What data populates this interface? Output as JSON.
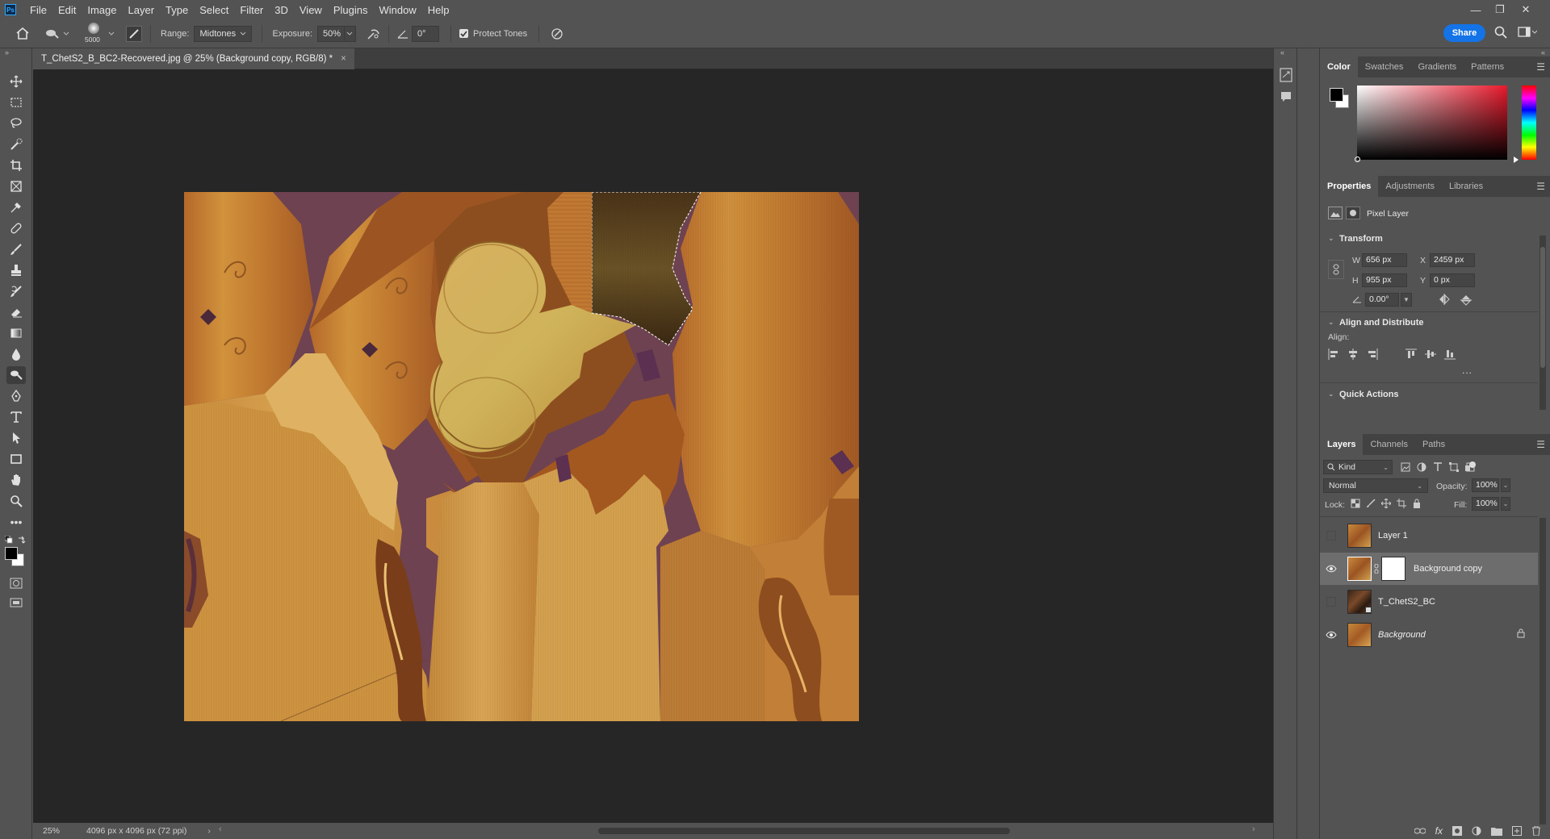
{
  "app": {
    "logo": "Ps"
  },
  "menu": [
    "File",
    "Edit",
    "Image",
    "Layer",
    "Type",
    "Select",
    "Filter",
    "3D",
    "View",
    "Plugins",
    "Window",
    "Help"
  ],
  "window_controls": [
    "minimize-icon",
    "restore-icon",
    "close-icon"
  ],
  "options": {
    "brush_size": "5000",
    "range_label": "Range:",
    "range_value": "Midtones",
    "exposure_label": "Exposure:",
    "exposure_value": "50%",
    "angle_value": "0°",
    "protect_tones_label": "Protect Tones",
    "protect_tones_checked": true,
    "share_label": "Share"
  },
  "document": {
    "tab_title": "T_ChetS2_B_BC2-Recovered.jpg @ 25% (Background copy, RGB/8) *",
    "close": "×",
    "zoom": "25%",
    "info": "4096 px x 4096 px (72 ppi)"
  },
  "tools": [
    "move-tool",
    "marquee-tool",
    "lasso-tool",
    "quick-selection-tool",
    "crop-tool",
    "frame-tool",
    "eyedropper-tool",
    "healing-brush-tool",
    "brush-tool",
    "clone-stamp-tool",
    "history-brush-tool",
    "eraser-tool",
    "gradient-tool",
    "blur-tool",
    "dodge-tool",
    "pen-tool",
    "type-tool",
    "path-selection-tool",
    "rectangle-tool",
    "hand-tool",
    "zoom-tool",
    "more-tools"
  ],
  "color_panel": {
    "tabs": [
      "Color",
      "Swatches",
      "Gradients",
      "Patterns"
    ],
    "active_tab": "Color",
    "hue_color": "#e8192c",
    "foreground": "#000000",
    "background": "#ffffff"
  },
  "properties_panel": {
    "tabs": [
      "Properties",
      "Adjustments",
      "Libraries"
    ],
    "active_tab": "Properties",
    "layer_kind": "Pixel Layer",
    "transform_title": "Transform",
    "w_label": "W",
    "w_value": "656 px",
    "h_label": "H",
    "h_value": "955 px",
    "x_label": "X",
    "x_value": "2459 px",
    "y_label": "Y",
    "y_value": "0 px",
    "angle_value": "0.00°",
    "align_title": "Align and Distribute",
    "align_label": "Align:",
    "more": "...",
    "quick_actions_title": "Quick Actions"
  },
  "layers_panel": {
    "tabs": [
      "Layers",
      "Channels",
      "Paths"
    ],
    "active_tab": "Layers",
    "filter_kind": "Kind",
    "blend_mode": "Normal",
    "opacity_label": "Opacity:",
    "opacity_value": "100%",
    "lock_label": "Lock:",
    "fill_label": "Fill:",
    "fill_value": "100%",
    "layers": [
      {
        "name": "Layer 1",
        "visible": false,
        "selected": false,
        "italic": false,
        "mask": false,
        "locked": false
      },
      {
        "name": "Background copy",
        "visible": true,
        "selected": true,
        "italic": false,
        "mask": true,
        "locked": false
      },
      {
        "name": "T_ChetS2_BC",
        "visible": false,
        "selected": false,
        "italic": false,
        "mask": false,
        "locked": false
      },
      {
        "name": "Background",
        "visible": true,
        "selected": false,
        "italic": true,
        "mask": false,
        "locked": true
      }
    ]
  }
}
